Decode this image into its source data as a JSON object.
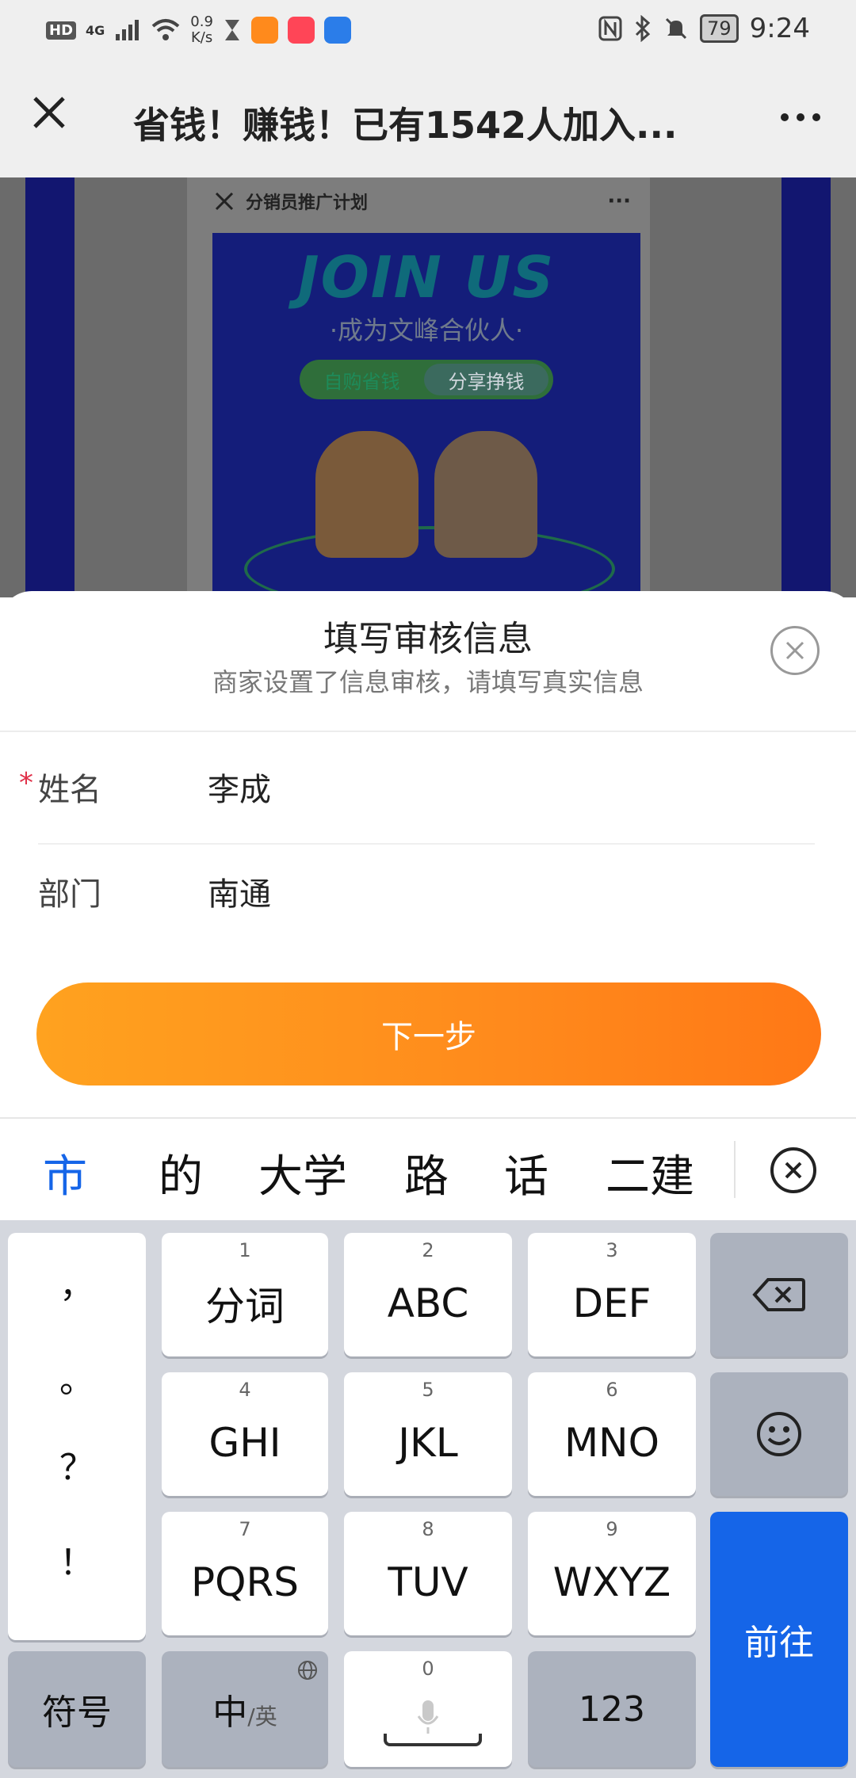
{
  "status_bar": {
    "hd": "HD",
    "network": "4G",
    "speed_value": "0.9",
    "speed_unit": "K/s",
    "battery": "79",
    "time": "9:24"
  },
  "title_bar": {
    "title": "省钱！赚钱！已有1542人加入..."
  },
  "background_page": {
    "header": "分销员推广计划",
    "poster_title": "JOIN US",
    "poster_subtitle": "·成为文峰合伙人·",
    "pill_left": "自购省钱",
    "pill_right": "分享挣钱"
  },
  "sheet": {
    "title": "填写审核信息",
    "subtitle": "商家设置了信息审核，请填写真实信息",
    "fields": [
      {
        "required_mark": "*",
        "label": "姓名",
        "value": "李成"
      },
      {
        "required_mark": "",
        "label": "部门",
        "value": "南通"
      }
    ],
    "next_button": "下一步"
  },
  "candidates": [
    "市",
    "的",
    "大学",
    "路",
    "话",
    "二建"
  ],
  "keyboard": {
    "punctuation": [
      "，",
      "。",
      "？",
      "！"
    ],
    "keys": [
      {
        "num": "1",
        "label": "分词"
      },
      {
        "num": "2",
        "label": "ABC"
      },
      {
        "num": "3",
        "label": "DEF"
      },
      {
        "num": "4",
        "label": "GHI"
      },
      {
        "num": "5",
        "label": "JKL"
      },
      {
        "num": "6",
        "label": "MNO"
      },
      {
        "num": "7",
        "label": "PQRS"
      },
      {
        "num": "8",
        "label": "TUV"
      },
      {
        "num": "9",
        "label": "WXYZ"
      }
    ],
    "symbols": "符号",
    "lang_main": "中",
    "lang_sub": "/英",
    "space_num": "0",
    "numbers": "123",
    "go": "前往"
  },
  "colors": {
    "accent_orange": "#ff8a1c",
    "keyboard_blue": "#1565e8",
    "required_red": "#e0324a"
  },
  "icons": [
    "close-icon",
    "more-icon",
    "backspace-icon",
    "emoji-icon",
    "globe-icon",
    "mic-icon",
    "candidate-close-icon"
  ]
}
